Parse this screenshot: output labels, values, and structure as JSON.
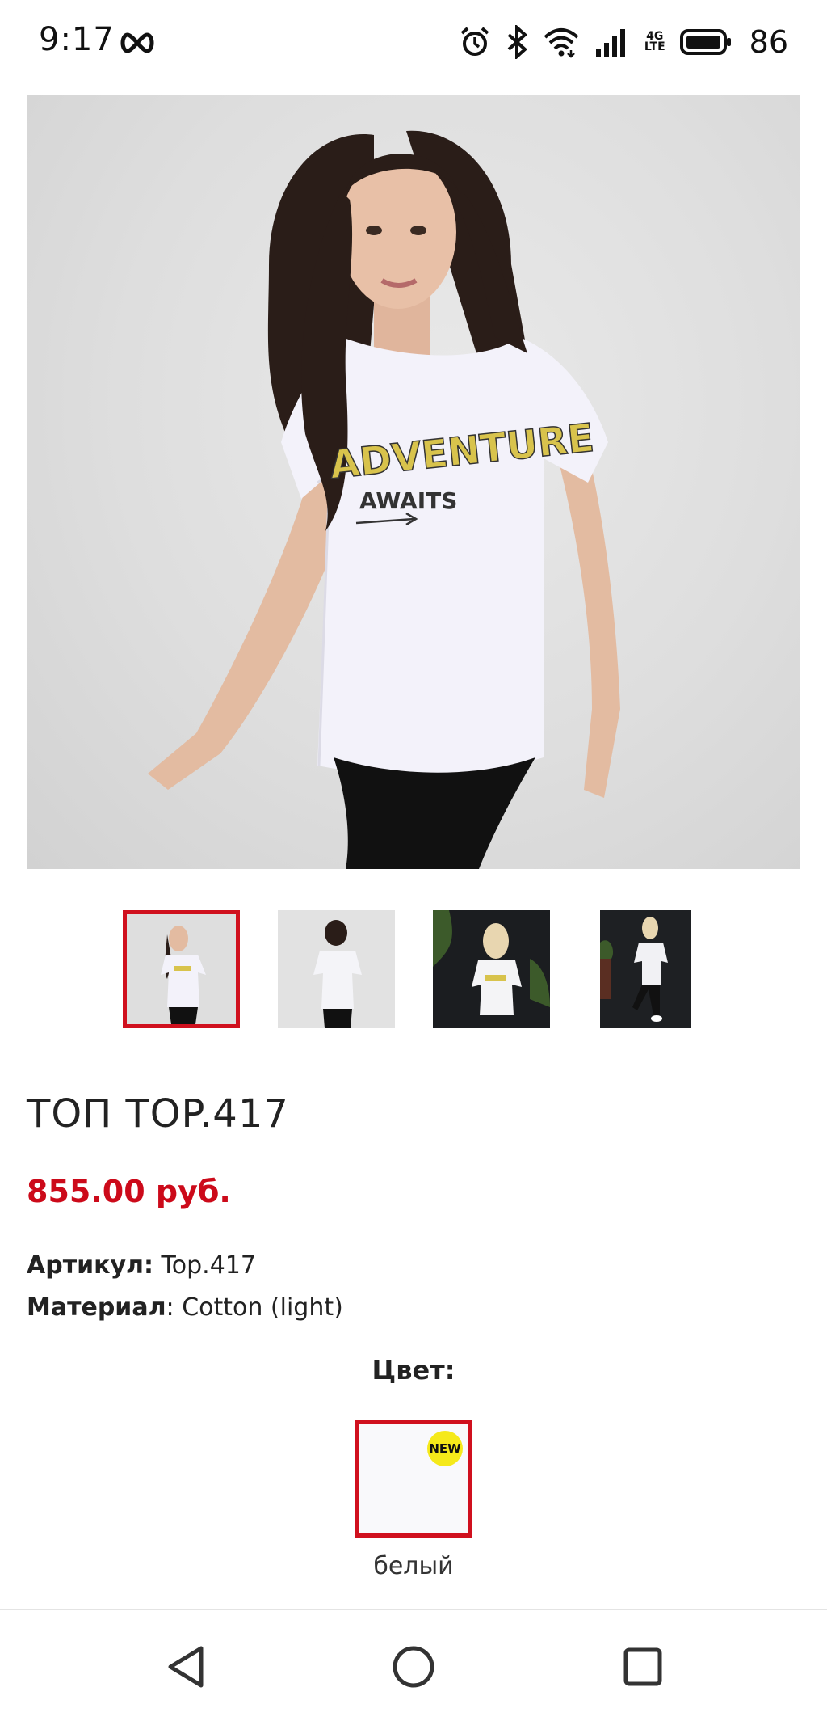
{
  "status_bar": {
    "time": "9:17",
    "network_label": "4G LTE",
    "battery": "86"
  },
  "product": {
    "title": "ТОП TOP.417",
    "price": "855.00 руб.",
    "article_label": "Артикул:",
    "article_value": "Top.417",
    "material_label": "Материал",
    "material_value": ": Cotton (light)",
    "print_line1": "ADVENTURE",
    "print_line2": "AWAITS"
  },
  "color": {
    "label": "Цвет:",
    "swatch_name": "белый",
    "badge": "NEW"
  },
  "colors": {
    "accent": "#d0101e",
    "price": "#cc0a1a",
    "badge": "#f5e91a"
  },
  "icons": {
    "nav_back": "triangle-back-icon",
    "nav_home": "circle-home-icon",
    "nav_recents": "square-recents-icon"
  }
}
